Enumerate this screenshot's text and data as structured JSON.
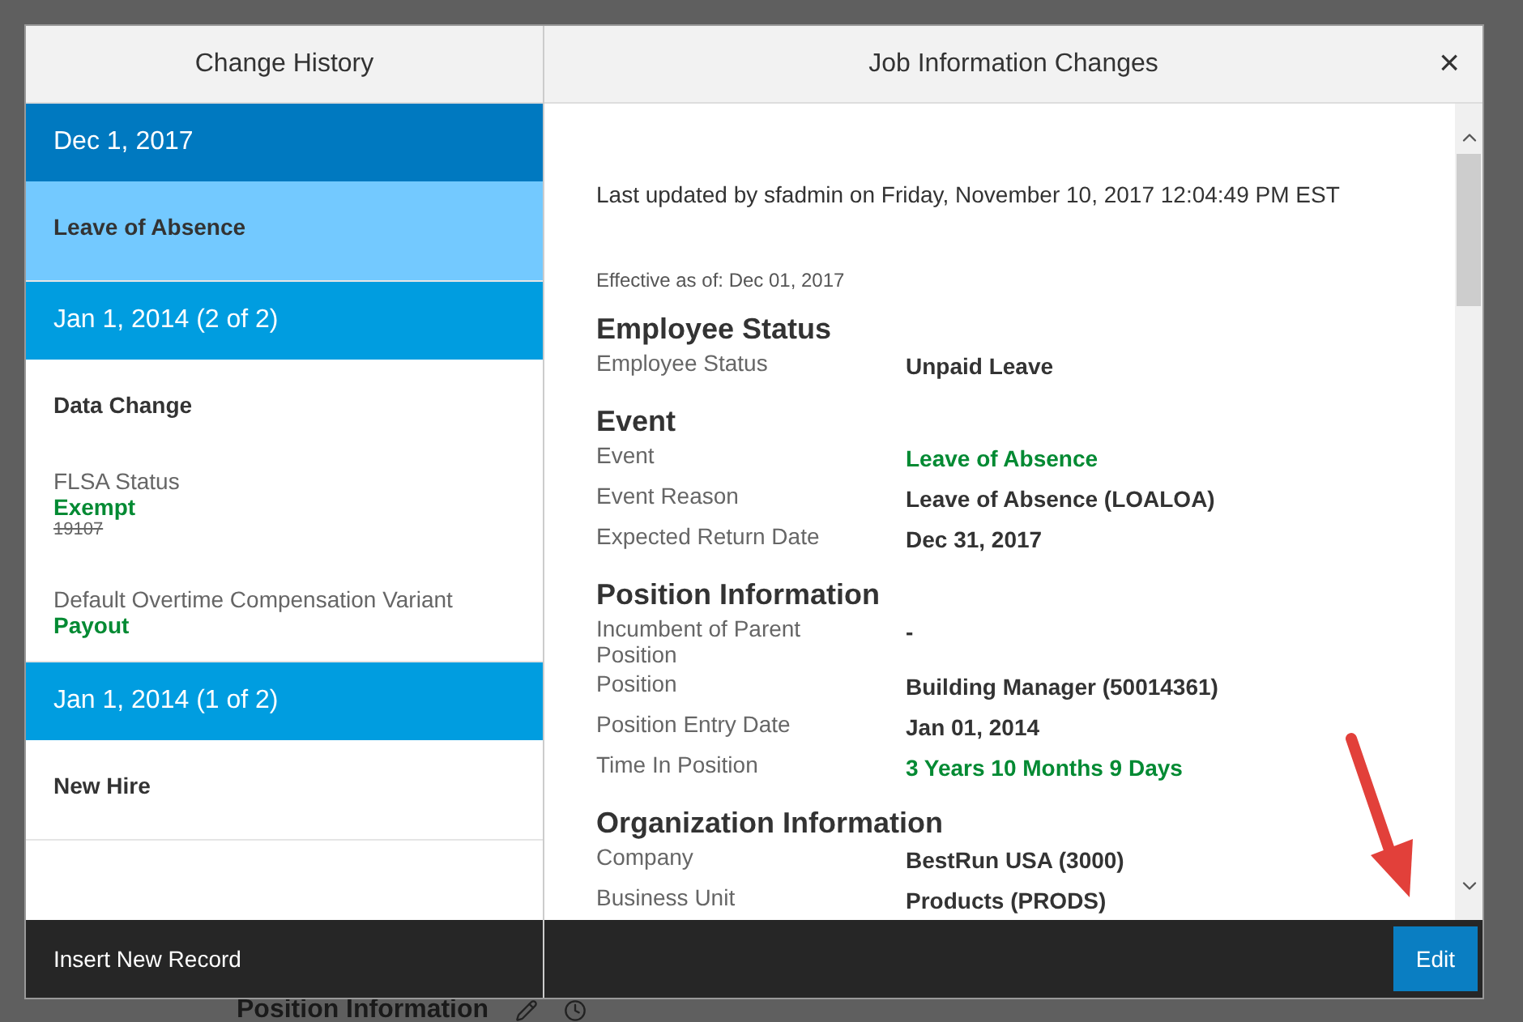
{
  "background": {
    "heading": "Position Information"
  },
  "dialog": {
    "left_title": "Change History",
    "right_title": "Job Information Changes",
    "close": "×",
    "history": [
      {
        "date": "Dec 1, 2017",
        "selected": true,
        "entries": [
          {
            "title": "Leave of Absence",
            "selected": true
          }
        ]
      },
      {
        "date": "Jan 1, 2014 (2 of 2)",
        "selected": false,
        "entries": [
          {
            "title": "Data Change",
            "selected": false,
            "changes": [
              {
                "label": "FLSA Status",
                "new_value": "Exempt",
                "old_value": "19107"
              },
              {
                "label": "Default Overtime Compensation Variant",
                "new_value": "Payout"
              }
            ]
          }
        ]
      },
      {
        "date": "Jan 1, 2014 (1 of 2)",
        "selected": false,
        "entries": [
          {
            "title": "New Hire",
            "selected": false
          }
        ]
      }
    ],
    "last_updated": "Last updated by sfadmin on Friday, November 10, 2017 12:04:49 PM EST",
    "effective": "Effective as of: Dec 01, 2017",
    "sections": [
      {
        "title": "Employee Status",
        "rows": [
          {
            "label": "Employee Status",
            "value": "Unpaid Leave",
            "changed": false
          }
        ]
      },
      {
        "title": "Event",
        "rows": [
          {
            "label": "Event",
            "value": "Leave of Absence",
            "changed": true
          },
          {
            "label": "Event Reason",
            "value": "Leave of Absence (LOALOA)",
            "changed": false
          },
          {
            "label": "Expected Return Date",
            "value": "Dec 31, 2017",
            "changed": false
          }
        ]
      },
      {
        "title": "Position Information",
        "rows": [
          {
            "label": "Incumbent of Parent Position",
            "value": "-",
            "changed": false
          },
          {
            "label": "Position",
            "value": "Building Manager (50014361)",
            "changed": false
          },
          {
            "label": "Position Entry Date",
            "value": "Jan 01, 2014",
            "changed": false
          },
          {
            "label": "Time In Position",
            "value": "3 Years 10 Months 9 Days",
            "changed": true
          }
        ]
      },
      {
        "title": "Organization Information",
        "rows": [
          {
            "label": "Company",
            "value": "BestRun USA (3000)",
            "changed": false
          },
          {
            "label": "Business Unit",
            "value": "Products (PRODS)",
            "changed": false
          }
        ]
      }
    ],
    "left_button": "Insert New Record",
    "edit_button": "Edit"
  }
}
